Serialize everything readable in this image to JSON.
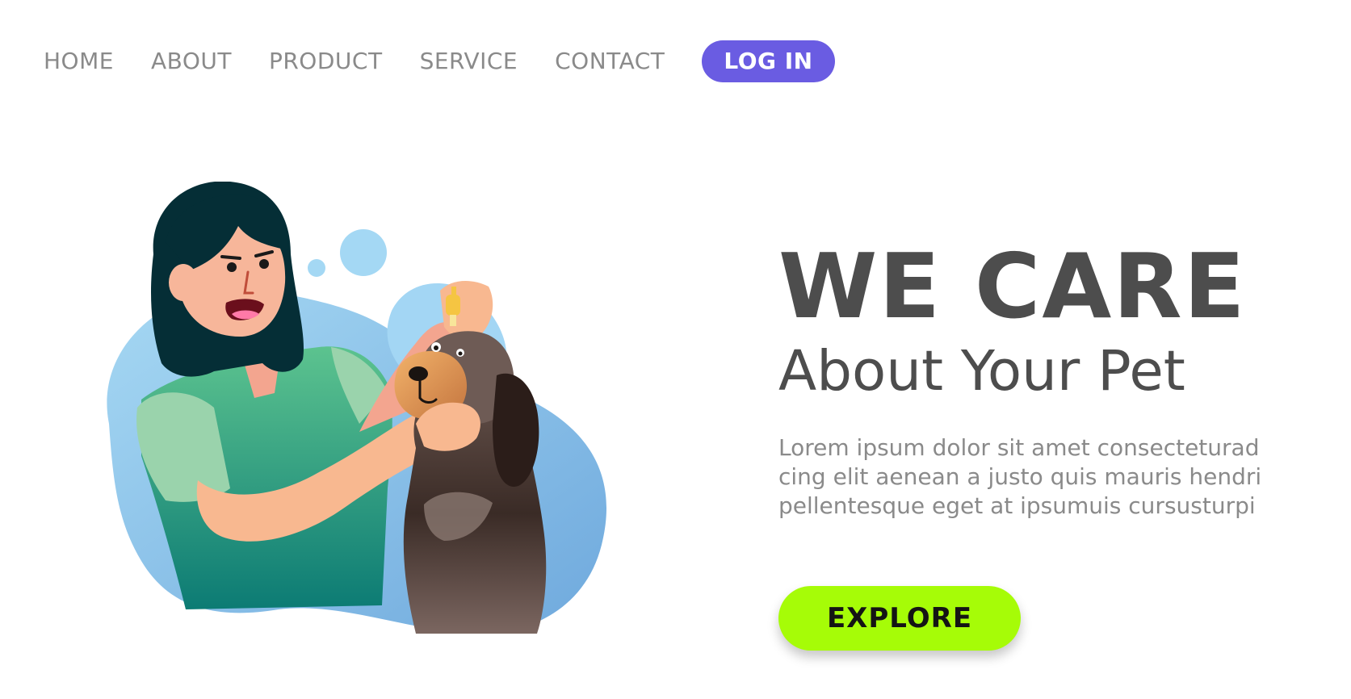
{
  "nav": {
    "links": [
      {
        "label": "HOME"
      },
      {
        "label": "ABOUT"
      },
      {
        "label": "PRODUCT"
      },
      {
        "label": "SERVICE"
      },
      {
        "label": "CONTACT"
      }
    ],
    "login_label": "LOG IN"
  },
  "hero": {
    "title": "WE CARE",
    "subtitle": "About Your Pet",
    "body_lines": [
      "Lorem ipsum dolor sit amet consecteturad",
      "cing elit aenean a justo quis mauris hendri",
      "pellentesque eget at ipsumuis cursusturpi"
    ],
    "cta_label": "EXPLORE"
  },
  "colors": {
    "accent": "#6a5ce2",
    "cta": "#a6fc07",
    "heading": "#4d4d4d",
    "muted": "#8a8a8a",
    "blob": "#8fc8ee"
  },
  "illustration": {
    "subject": "woman-giving-eye-drops-to-dog"
  }
}
